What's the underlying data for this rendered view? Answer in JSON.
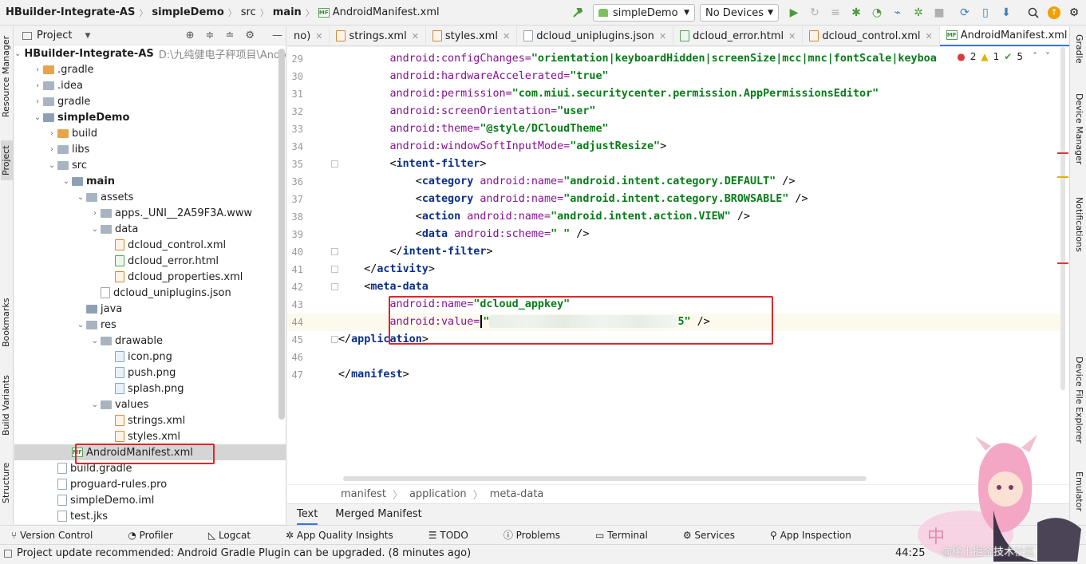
{
  "breadcrumb": [
    "HBuilder-Integrate-AS",
    "simpleDemo",
    "src",
    "main",
    "AndroidManifest.xml"
  ],
  "run_config": "simpleDemo",
  "device": "No Devices",
  "project_panel": {
    "title": "Project",
    "tree": [
      {
        "label": "HBuilder-Integrate-AS",
        "extra": "D:\\九纯健电子秤项目\\Androi",
        "type": "module",
        "arrow": "down"
      },
      {
        "label": ".gradle",
        "type": "folder-orange",
        "arrow": "right"
      },
      {
        "label": ".idea",
        "type": "folder",
        "arrow": "right"
      },
      {
        "label": "gradle",
        "type": "folder",
        "arrow": "right"
      },
      {
        "label": "simpleDemo",
        "type": "module",
        "arrow": "down"
      },
      {
        "label": "build",
        "type": "folder-orange",
        "arrow": "right"
      },
      {
        "label": "libs",
        "type": "folder",
        "arrow": "right"
      },
      {
        "label": "src",
        "type": "folder",
        "arrow": "down"
      },
      {
        "label": "main",
        "type": "folder-src",
        "arrow": "down"
      },
      {
        "label": "assets",
        "type": "folder",
        "arrow": "down"
      },
      {
        "label": "apps._UNI__2A59F3A.www",
        "type": "folder",
        "arrow": "right"
      },
      {
        "label": "data",
        "type": "folder",
        "arrow": "down"
      },
      {
        "label": "dcloud_control.xml",
        "type": "file-xml",
        "arrow": ""
      },
      {
        "label": "dcloud_error.html",
        "type": "file-html",
        "arrow": ""
      },
      {
        "label": "dcloud_properties.xml",
        "type": "file-xml",
        "arrow": ""
      },
      {
        "label": "dcloud_uniplugins.json",
        "type": "file",
        "arrow": ""
      },
      {
        "label": "java",
        "type": "folder-src",
        "arrow": ""
      },
      {
        "label": "res",
        "type": "folder",
        "arrow": "down"
      },
      {
        "label": "drawable",
        "type": "folder",
        "arrow": "down"
      },
      {
        "label": "icon.png",
        "type": "file-png",
        "arrow": ""
      },
      {
        "label": "push.png",
        "type": "file-png",
        "arrow": ""
      },
      {
        "label": "splash.png",
        "type": "file-png",
        "arrow": ""
      },
      {
        "label": "values",
        "type": "folder",
        "arrow": "down"
      },
      {
        "label": "strings.xml",
        "type": "file-xml",
        "arrow": ""
      },
      {
        "label": "styles.xml",
        "type": "file-xml",
        "arrow": ""
      },
      {
        "label": "AndroidManifest.xml",
        "type": "file-mf",
        "arrow": "",
        "selected": true
      },
      {
        "label": "build.gradle",
        "type": "file",
        "arrow": ""
      },
      {
        "label": "proguard-rules.pro",
        "type": "file",
        "arrow": ""
      },
      {
        "label": "simpleDemo.iml",
        "type": "file",
        "arrow": ""
      },
      {
        "label": "test.jks",
        "type": "file",
        "arrow": ""
      }
    ]
  },
  "editor_tabs": [
    {
      "label": "no)"
    },
    {
      "label": "strings.xml"
    },
    {
      "label": "styles.xml"
    },
    {
      "label": "dcloud_uniplugins.json"
    },
    {
      "label": "dcloud_error.html"
    },
    {
      "label": "dcloud_control.xml"
    },
    {
      "label": "AndroidManifest.xml",
      "active": true
    }
  ],
  "inspections": {
    "errors": "2",
    "warnings": "1",
    "ok": "5"
  },
  "code_lines": [
    {
      "n": "29",
      "parts": [
        [
          "at",
          "        android:configChanges="
        ],
        [
          "st",
          "\"orientation|keyboardHidden|screenSize|mcc|mnc|fontScale|keyboa"
        ]
      ]
    },
    {
      "n": "30",
      "parts": [
        [
          "at",
          "        android:hardwareAccelerated="
        ],
        [
          "st",
          "\"true\""
        ]
      ]
    },
    {
      "n": "31",
      "parts": [
        [
          "at",
          "        android:permission="
        ],
        [
          "st",
          "\"com.miui.securitycenter.permission.AppPermissionsEditor\""
        ]
      ]
    },
    {
      "n": "32",
      "parts": [
        [
          "at",
          "        android:screenOrientation="
        ],
        [
          "st",
          "\"user\""
        ]
      ]
    },
    {
      "n": "33",
      "parts": [
        [
          "at",
          "        android:theme="
        ],
        [
          "st",
          "\"@style/DCloudTheme\""
        ]
      ]
    },
    {
      "n": "34",
      "parts": [
        [
          "at",
          "        android:windowSoftInputMode="
        ],
        [
          "st",
          "\"adjustResize\""
        ],
        [
          "pl",
          ">"
        ]
      ]
    },
    {
      "n": "35",
      "parts": [
        [
          "pl",
          "        <"
        ],
        [
          "tg",
          "intent-filter"
        ],
        [
          "pl",
          ">"
        ]
      ]
    },
    {
      "n": "36",
      "parts": [
        [
          "pl",
          "            <"
        ],
        [
          "tg",
          "category "
        ],
        [
          "at",
          "android:name="
        ],
        [
          "st",
          "\"android.intent.category.DEFAULT\""
        ],
        [
          "pl",
          " />"
        ]
      ]
    },
    {
      "n": "37",
      "parts": [
        [
          "pl",
          "            <"
        ],
        [
          "tg",
          "category "
        ],
        [
          "at",
          "android:name="
        ],
        [
          "st",
          "\"android.intent.category.BROWSABLE\""
        ],
        [
          "pl",
          " />"
        ]
      ]
    },
    {
      "n": "38",
      "parts": [
        [
          "pl",
          "            <"
        ],
        [
          "tg",
          "action "
        ],
        [
          "at",
          "android:name="
        ],
        [
          "st",
          "\"android.intent.action.VIEW\""
        ],
        [
          "pl",
          " />"
        ]
      ]
    },
    {
      "n": "39",
      "parts": [
        [
          "pl",
          "            <"
        ],
        [
          "tg",
          "data "
        ],
        [
          "at",
          "android:scheme="
        ],
        [
          "st",
          "\" \""
        ],
        [
          "pl",
          " />"
        ]
      ]
    },
    {
      "n": "40",
      "parts": [
        [
          "pl",
          "        </"
        ],
        [
          "tg",
          "intent-filter"
        ],
        [
          "pl",
          ">"
        ]
      ]
    },
    {
      "n": "41",
      "parts": [
        [
          "pl",
          "    </"
        ],
        [
          "tg",
          "activity"
        ],
        [
          "pl",
          ">"
        ]
      ]
    },
    {
      "n": "42",
      "parts": [
        [
          "pl",
          "    <"
        ],
        [
          "tg",
          "meta-data"
        ]
      ]
    },
    {
      "n": "43",
      "parts": [
        [
          "at",
          "        android:name="
        ],
        [
          "st",
          "\"dcloud_appkey\""
        ]
      ]
    },
    {
      "n": "44",
      "parts": []
    },
    {
      "n": "45",
      "parts": [
        [
          "pl",
          "</"
        ],
        [
          "tg",
          "application"
        ],
        [
          "pl",
          ">"
        ]
      ]
    },
    {
      "n": "46",
      "parts": []
    },
    {
      "n": "47",
      "parts": [
        [
          "pl",
          "</"
        ],
        [
          "tg",
          "manifest"
        ],
        [
          "pl",
          ">"
        ]
      ]
    }
  ],
  "line44": {
    "attr": "android:value=",
    "quote_open": "\"",
    "quote_close": "5\"",
    "close": " />"
  },
  "editor_breadcrumb": [
    "manifest",
    "application",
    "meta-data"
  ],
  "bottom_tabs": [
    "Text",
    "Merged Manifest"
  ],
  "tool_windows": [
    "Version Control",
    "Profiler",
    "Logcat",
    "App Quality Insights",
    "TODO",
    "Problems",
    "Terminal",
    "Services",
    "App Inspection"
  ],
  "left_strip": [
    "Resource Manager",
    "Project",
    "Bookmarks",
    "Build Variants",
    "Structure"
  ],
  "right_strip": [
    "Gradle",
    "Device Manager",
    "Notifications",
    "Device File Explorer",
    "Emulator"
  ],
  "status": {
    "message": "Project update recommended: Android Gradle Plugin can be upgraded. (8 minutes ago)",
    "position": "44:25"
  },
  "watermark": "@稀土掘金技术社区"
}
